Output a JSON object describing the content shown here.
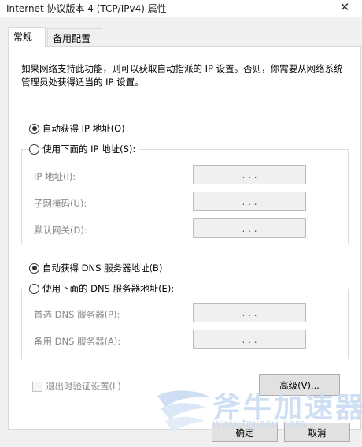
{
  "window": {
    "title": "Internet 协议版本 4 (TCP/IPv4) 属性",
    "close_glyph": "✕"
  },
  "tabs": [
    {
      "label": "常规",
      "active": true
    },
    {
      "label": "备用配置",
      "active": false
    }
  ],
  "general": {
    "description": "如果网络支持此功能，则可以获取自动指派的 IP 设置。否则，你需要从网络系统管理员处获得适当的 IP 设置。",
    "ip_auto_label": "自动获得 IP 地址(O)",
    "ip_auto_checked": true,
    "ip_manual_label": "使用下面的 IP 地址(S):",
    "ip_manual_checked": false,
    "ip_fields": [
      {
        "label": "IP 地址(I):",
        "value": ".     .     ."
      },
      {
        "label": "子网掩码(U):",
        "value": ".     .     ."
      },
      {
        "label": "默认网关(D):",
        "value": ".     .     ."
      }
    ],
    "dns_auto_label": "自动获得 DNS 服务器地址(B)",
    "dns_auto_checked": true,
    "dns_manual_label": "使用下面的 DNS 服务器地址(E):",
    "dns_manual_checked": false,
    "dns_fields": [
      {
        "label": "首选 DNS 服务器(P):",
        "value": ".     .     ."
      },
      {
        "label": "备用 DNS 服务器(A):",
        "value": ".     .     ."
      }
    ],
    "validate_label": "退出时验证设置(L)",
    "validate_checked": false,
    "advanced_button": "高级(V)..."
  },
  "footer": {
    "ok_button": "确定",
    "cancel_button": "取消"
  },
  "watermark": {
    "brand": "斧牛加速器",
    "url": "www.fnjiasu.com"
  },
  "colors": {
    "dialog_bg": "#f0f0f0",
    "panel_bg": "#ffffff",
    "disabled_text": "#8a8a8a",
    "watermark": "#c9dcf2"
  }
}
